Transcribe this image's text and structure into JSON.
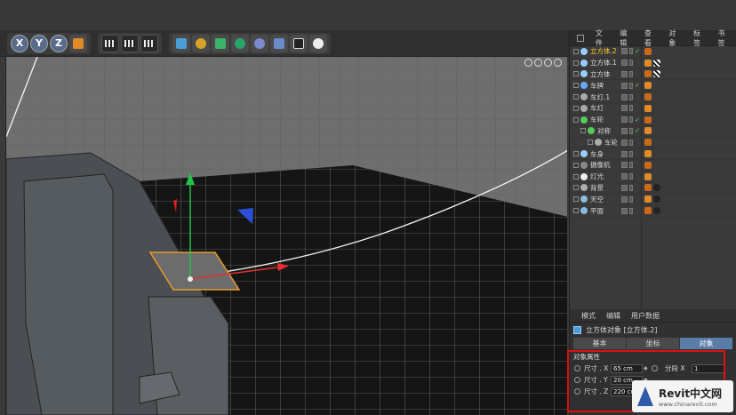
{
  "app": {
    "colors": {
      "accent": "#5a7da8",
      "selected": "#ffcc33",
      "highlight_box": "#dd1111"
    }
  },
  "toolbar": {
    "axis_buttons": [
      "X",
      "Y",
      "Z"
    ],
    "icons": [
      "coordinate-system-icon",
      "render-view-icon",
      "render-picture-icon",
      "render-settings-icon",
      "cube-icon",
      "pen-icon",
      "subdivision-icon",
      "array-icon",
      "deformer-icon",
      "scene-floor-icon",
      "camera-icon",
      "light-icon"
    ]
  },
  "object_manager": {
    "menu": [
      "文件",
      "编辑",
      "查看",
      "对象",
      "标签",
      "书签"
    ],
    "objects": [
      {
        "name": "立方体.2",
        "selected": true,
        "icon": "#9cf",
        "check": true
      },
      {
        "name": "立方体.1",
        "selected": false,
        "icon": "#9cf",
        "check": false
      },
      {
        "name": "立方体",
        "selected": false,
        "icon": "#9cf",
        "check": false
      },
      {
        "name": "车牌",
        "selected": false,
        "icon": "#6af",
        "check": true
      },
      {
        "name": "车灯.1",
        "selected": false,
        "icon": "#aaa",
        "check": false
      },
      {
        "name": "车灯",
        "selected": false,
        "icon": "#aaa",
        "check": false
      },
      {
        "name": "车轮",
        "selected": false,
        "icon": "#5c5",
        "check": true
      },
      {
        "name": "对称",
        "selected": false,
        "icon": "#5c5",
        "check": true
      },
      {
        "name": "车轮",
        "selected": false,
        "icon": "#aaa",
        "check": false
      },
      {
        "name": "车身",
        "selected": false,
        "icon": "#9cf",
        "check": false
      },
      {
        "name": "摄像机",
        "selected": false,
        "icon": "#888",
        "check": false
      },
      {
        "name": "灯光",
        "selected": false,
        "icon": "#eee",
        "check": false
      },
      {
        "name": "背景",
        "selected": false,
        "icon": "#aaa",
        "check": false
      },
      {
        "name": "天空",
        "selected": false,
        "icon": "#8bd",
        "check": false
      },
      {
        "name": "平面",
        "selected": false,
        "icon": "#8bd",
        "check": false
      }
    ]
  },
  "attributes": {
    "menu": [
      "模式",
      "编辑",
      "用户数据"
    ],
    "title": "立方体对象 [立方体.2]",
    "tabs": [
      "基本",
      "坐标",
      "对象"
    ],
    "active_tab": "对象",
    "section": "对象属性",
    "props": [
      {
        "label": "尺寸 . X",
        "value": "65 cm",
        "extra_label": "分段 X",
        "extra_value": "1"
      },
      {
        "label": "尺寸 . Y",
        "value": "20 cm"
      },
      {
        "label": "尺寸 . Z",
        "value": "220 cm"
      }
    ]
  },
  "watermark": {
    "brand": "Revit中文网",
    "url": "www.chinarevit.com"
  }
}
